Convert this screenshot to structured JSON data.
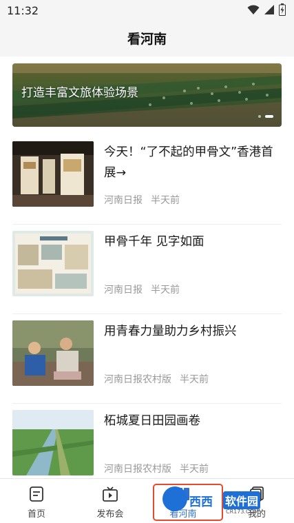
{
  "status_bar": {
    "time": "11:32"
  },
  "header": {
    "title": "看河南"
  },
  "banner": {
    "caption": "打造丰富文旅体验场景"
  },
  "news": [
    {
      "title": "今天！“了不起的甲骨文”香港首展→",
      "source": "河南日报",
      "time": "半天前"
    },
    {
      "title": "甲骨千年 见字如面",
      "source": "河南日报",
      "time": "半天前"
    },
    {
      "title": "用青春力量助力乡村振兴",
      "source": "河南日报农村版",
      "time": "半天前"
    },
    {
      "title": "柘城夏日田园画卷",
      "source": "河南日报农村版",
      "time": "半天前"
    }
  ],
  "tabs": [
    {
      "label": "首页",
      "icon": "document-icon"
    },
    {
      "label": "发布会",
      "icon": "tv-icon"
    },
    {
      "label": "看河南",
      "icon": "book-icon"
    },
    {
      "label": "我的",
      "icon": "pages-icon"
    }
  ],
  "watermark": {
    "brand": "西西",
    "product": "软件园",
    "domain": "CR173.COM"
  },
  "colors": {
    "accent": "#1e6fd6",
    "watermark_border": "#e54a2c"
  }
}
